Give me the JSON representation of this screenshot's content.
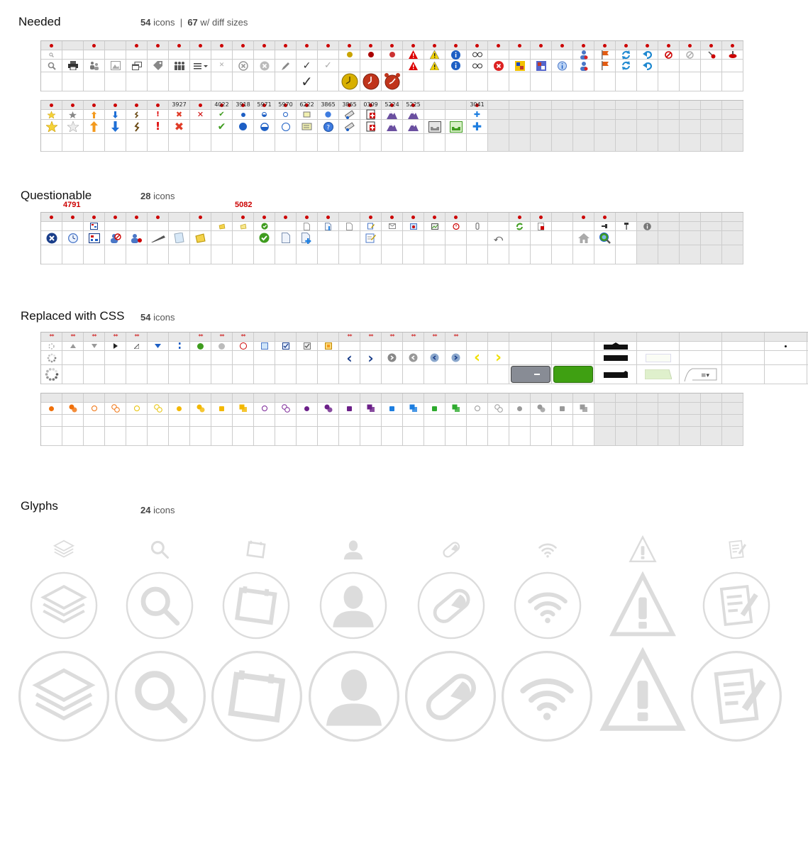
{
  "sections": {
    "needed": {
      "title": "Needed",
      "count_num": "54",
      "count_word": "icons",
      "sep": "|",
      "alt_num": "67",
      "alt_word": "w/ diff sizes"
    },
    "questionable": {
      "title": "Questionable",
      "count_num": "28",
      "count_word": "icons",
      "labels": [
        "4791",
        "5082"
      ]
    },
    "css": {
      "title": "Replaced with CSS",
      "count_num": "54",
      "count_word": "icons"
    },
    "glyphs": {
      "title": "Glyphs",
      "count_num": "24",
      "count_word": "icons"
    }
  },
  "needed_table2_numbers": [
    "3927",
    "4022",
    "3918",
    "5971",
    "5970",
    "6222",
    "3865",
    "3865",
    "0309",
    "5224",
    "5225",
    "3041"
  ],
  "css_marks": "**",
  "glyph_icons": [
    "layers-icon",
    "search-icon",
    "calendar-icon",
    "person-icon",
    "pill-icon",
    "wifi-icon",
    "warning-icon",
    "edit-icon"
  ],
  "colors": {
    "red": "#cc0000",
    "grid_header": "#e8e8e8",
    "glyph_gray": "#dcdcdc",
    "blue": "#1d5fc4",
    "green": "#3f9c1f"
  }
}
